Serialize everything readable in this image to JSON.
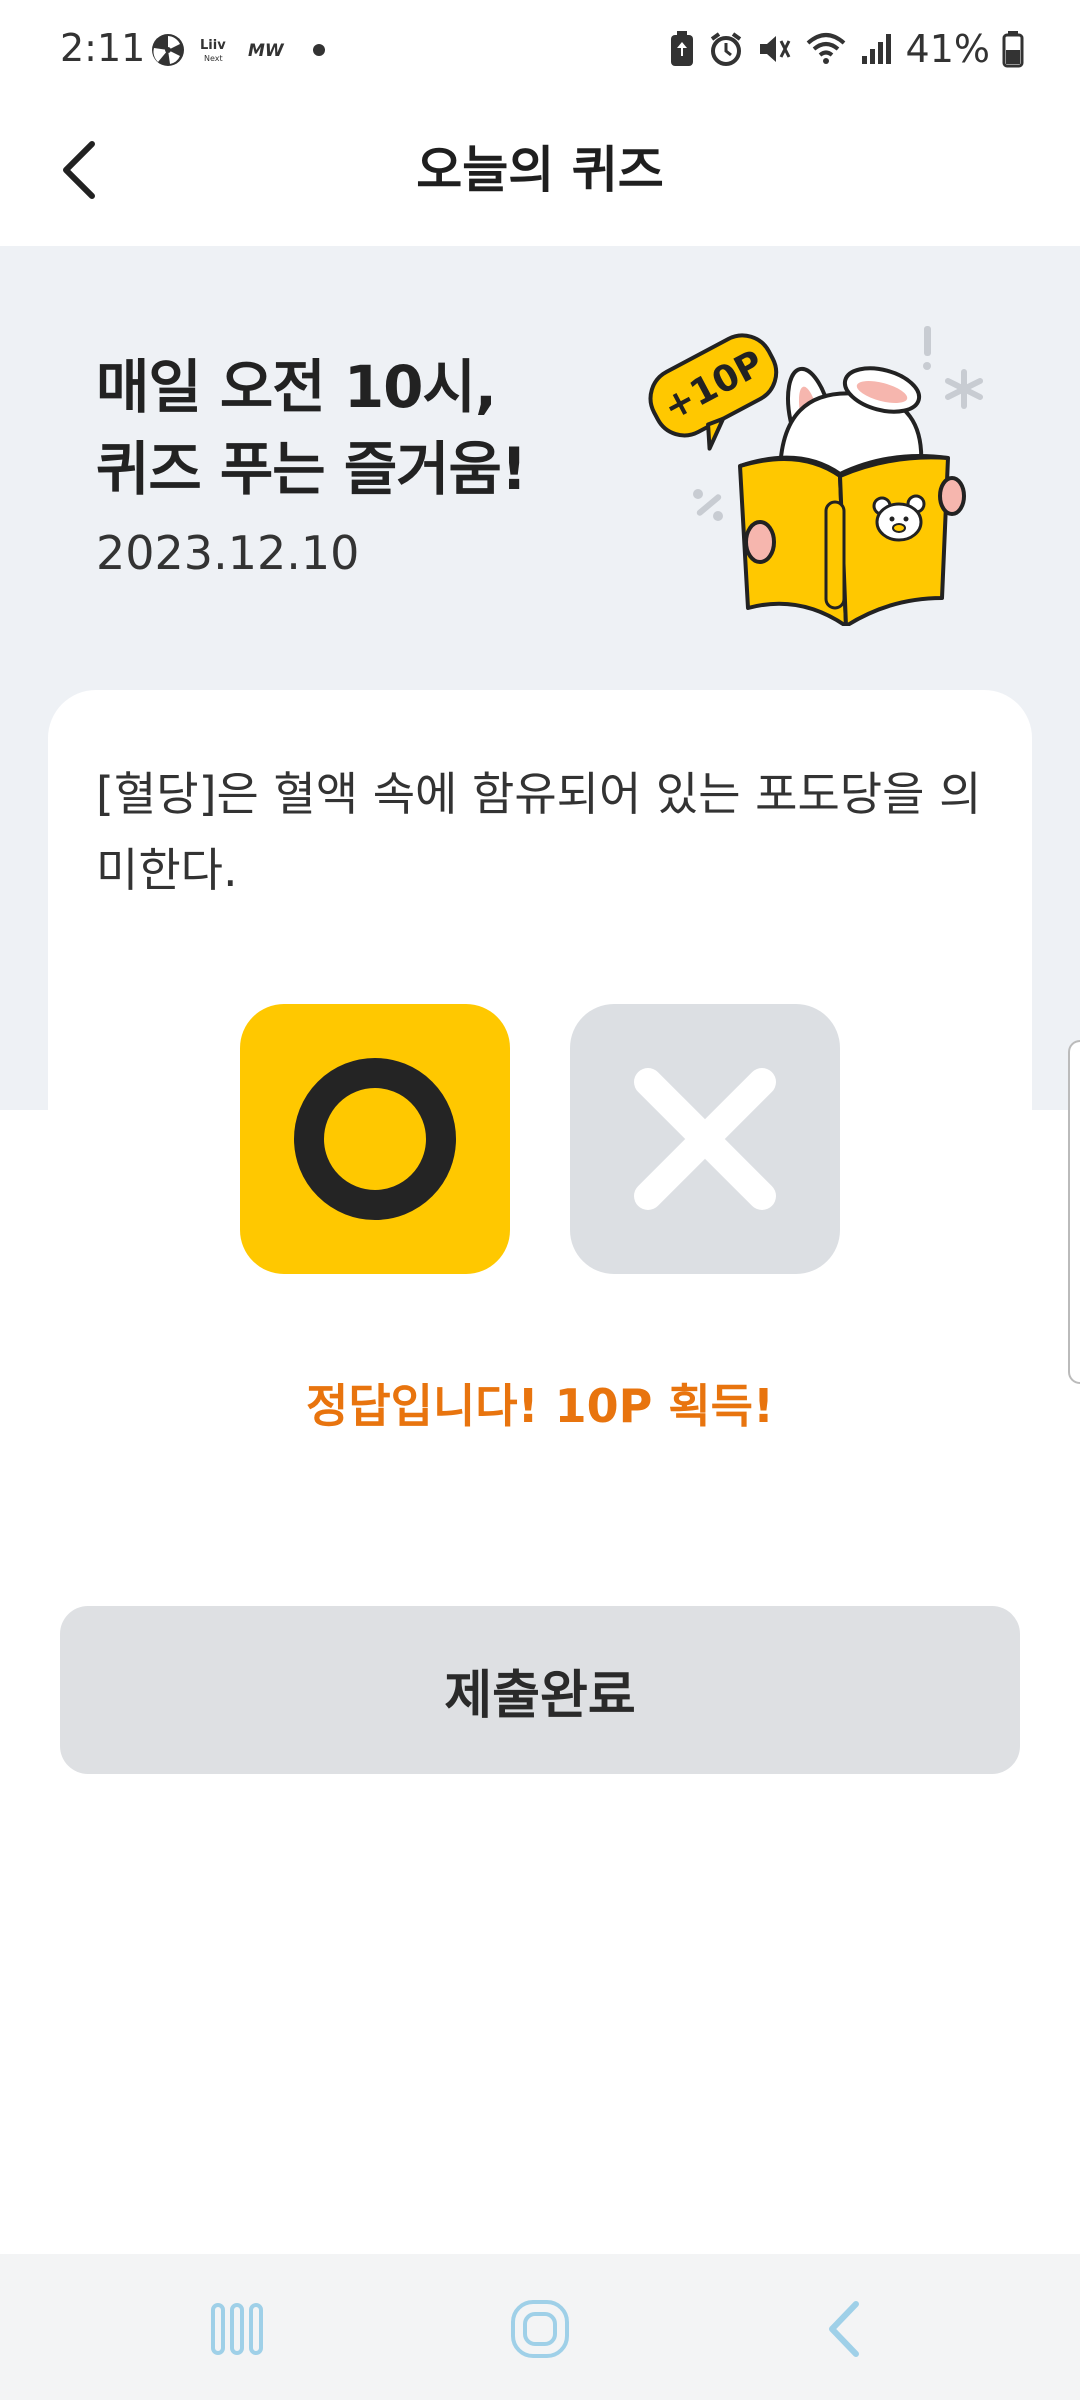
{
  "status_bar": {
    "time": "2:11",
    "battery": "41%",
    "left_icons": [
      "fan-icon",
      "liiv-next-icon",
      "mw-icon",
      "dot-icon"
    ],
    "right_icons": [
      "battery-saver-icon",
      "alarm-icon",
      "mute-icon",
      "wifi-icon",
      "signal-icon",
      "battery-icon"
    ]
  },
  "header": {
    "title": "오늘의 퀴즈",
    "back_icon": "chevron-left-icon"
  },
  "banner": {
    "title_line1": "매일 오전 10시,",
    "title_line2": "퀴즈 푸는 즐거움!",
    "date": "2023.12.10",
    "badge": "+10P"
  },
  "quiz": {
    "question": "[혈당]은 혈액 속에 함유되어 있는 포도당을 의미한다.",
    "option_o": "O",
    "option_x": "X",
    "selected": "O",
    "result": "정답입니다! 10P 획득!"
  },
  "submit": {
    "label": "제출완료"
  },
  "colors": {
    "accent_yellow": "#ffc800",
    "result_orange": "#e8740e",
    "banner_bg": "#eef1f5",
    "button_gray": "#dee0e3"
  },
  "nav": {
    "icons": [
      "recent-apps-icon",
      "home-icon",
      "back-icon"
    ]
  }
}
